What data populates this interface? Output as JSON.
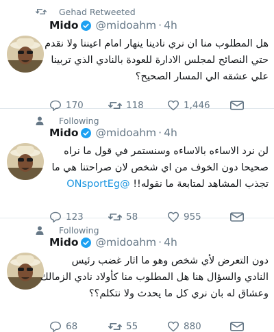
{
  "tweets": [
    {
      "context_text": "Gehad Retweeted",
      "context_icon": "retweet-icon",
      "name": "Mido",
      "handle": "@midoahm",
      "time": "4h",
      "lines": [
        "هل المطلوب منا ان نري نادينا ينهار امام اعيننا ولا نقدم",
        "حتي النصائح لمجلس الادارة للعودة بالنادي الذي تربينا",
        "علي عشقه الي المسار الصحيح؟"
      ],
      "replies": "170",
      "retweets": "118",
      "likes": "1,446"
    },
    {
      "context_text": "Following",
      "context_icon": "person-icon",
      "name": "Mido",
      "handle": "@midoahm",
      "time": "4h",
      "lines": [
        "لن نرد الاساءه بالاساءه وسنستمر في قول ما نراه",
        "صحيحا دون الخوف من اي شخص لان صراحتنا هي ما",
        "تجذب المشاهد لمتابعة ما نقوله!!"
      ],
      "mention": "@ONsportEg",
      "replies": "123",
      "retweets": "58",
      "likes": "955"
    },
    {
      "context_text": "Following",
      "context_icon": "person-icon",
      "name": "Mido",
      "handle": "@midoahm",
      "time": "4h",
      "lines": [
        "دون التعرض لأي شخص وهو ما اثار غضب رئيس",
        "النادي والسؤال هنا هل المطلوب منا كأولاد نادي الزمالك",
        "وعشاق له بان نري كل ما يحدث ولا نتكلم؟؟"
      ],
      "replies": "68",
      "retweets": "55",
      "likes": "880"
    }
  ],
  "colors": {
    "text": "#14171a",
    "secondary": "#657786",
    "link": "#1b95e0",
    "verified": "#1da1f2",
    "divider": "#e1e8ed"
  }
}
